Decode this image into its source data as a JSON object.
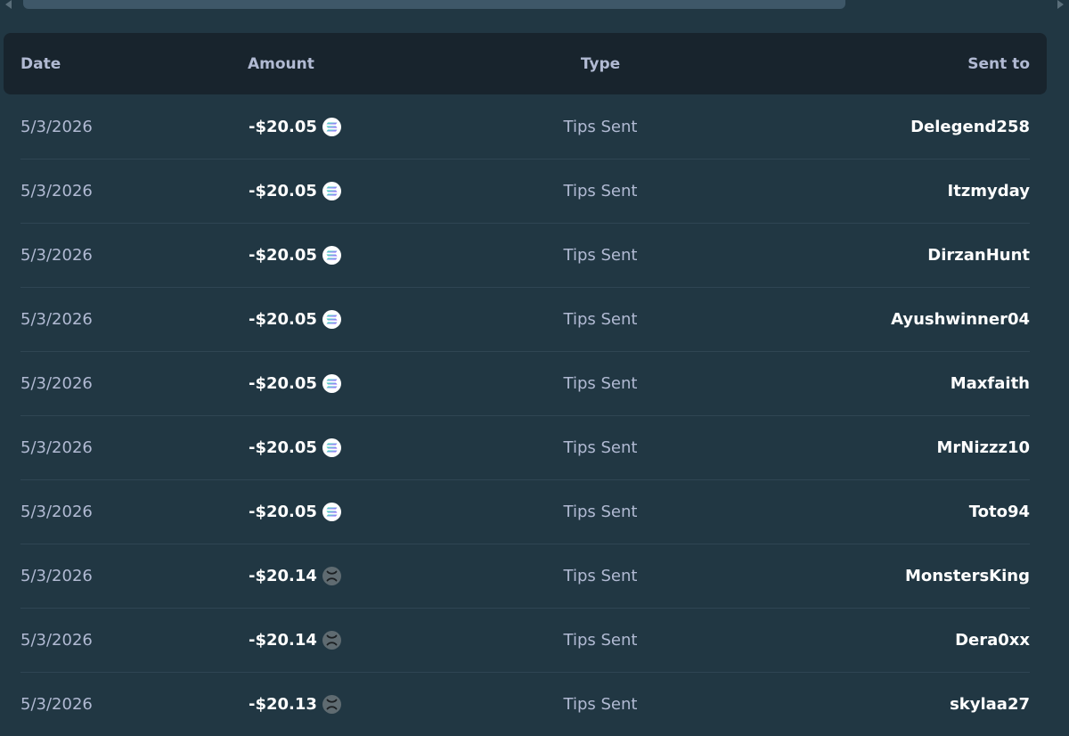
{
  "table": {
    "headers": {
      "date": "Date",
      "amount": "Amount",
      "type": "Type",
      "sent_to": "Sent to"
    },
    "rows": [
      {
        "date": "5/3/2026",
        "amount": "-$20.05",
        "currency_icon": "solana-icon",
        "type": "Tips Sent",
        "sent_to": "Delegend258"
      },
      {
        "date": "5/3/2026",
        "amount": "-$20.05",
        "currency_icon": "solana-icon",
        "type": "Tips Sent",
        "sent_to": "Itzmyday"
      },
      {
        "date": "5/3/2026",
        "amount": "-$20.05",
        "currency_icon": "solana-icon",
        "type": "Tips Sent",
        "sent_to": "DirzanHunt"
      },
      {
        "date": "5/3/2026",
        "amount": "-$20.05",
        "currency_icon": "solana-icon",
        "type": "Tips Sent",
        "sent_to": "Ayushwinner04"
      },
      {
        "date": "5/3/2026",
        "amount": "-$20.05",
        "currency_icon": "solana-icon",
        "type": "Tips Sent",
        "sent_to": "Maxfaith"
      },
      {
        "date": "5/3/2026",
        "amount": "-$20.05",
        "currency_icon": "solana-icon",
        "type": "Tips Sent",
        "sent_to": "MrNizzz10"
      },
      {
        "date": "5/3/2026",
        "amount": "-$20.05",
        "currency_icon": "solana-icon",
        "type": "Tips Sent",
        "sent_to": "Toto94"
      },
      {
        "date": "5/3/2026",
        "amount": "-$20.14",
        "currency_icon": "xrp-icon",
        "type": "Tips Sent",
        "sent_to": "MonstersKing"
      },
      {
        "date": "5/3/2026",
        "amount": "-$20.14",
        "currency_icon": "xrp-icon",
        "type": "Tips Sent",
        "sent_to": "Dera0xx"
      },
      {
        "date": "5/3/2026",
        "amount": "-$20.13",
        "currency_icon": "xrp-icon",
        "type": "Tips Sent",
        "sent_to": "skylaa27"
      }
    ]
  },
  "colors": {
    "background": "#213743",
    "header_background": "#18242d",
    "muted_text": "#b1bad3",
    "strong_text": "#ffffff",
    "divider": "#2f4553"
  }
}
